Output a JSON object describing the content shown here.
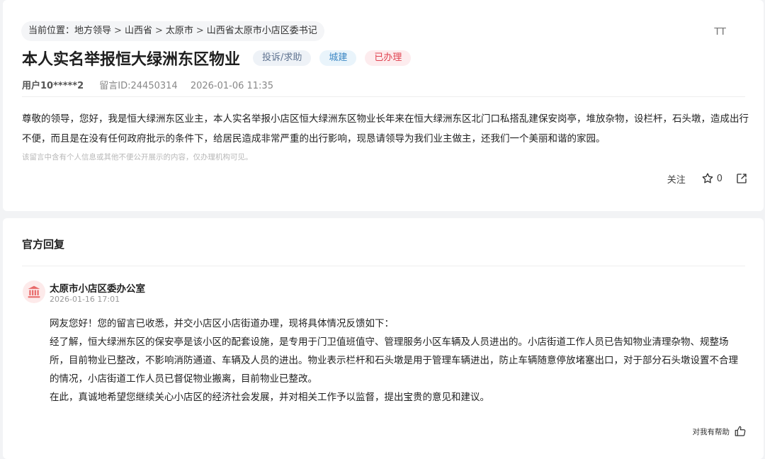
{
  "breadcrumb": {
    "prefix": "当前位置：",
    "items": [
      "地方领导",
      "山西省",
      "太原市",
      "山西省太原市小店区委书记"
    ],
    "separator": ">"
  },
  "font_size_toggle": "TT",
  "message": {
    "title": "本人实名举报恒大绿洲东区物业",
    "tags": {
      "type": "投诉/求助",
      "category": "城建",
      "status": "已办理"
    },
    "tag_colors": {
      "type": "#5f7390",
      "category": "#3b87c4",
      "status": "#e0414f"
    },
    "user": "用户10*****2",
    "message_id": "留言ID:24450314",
    "datetime": "2026-01-06 11:35",
    "content": "尊敬的领导，您好，我是恒大绿洲东区业主，本人实名举报小店区恒大绿洲东区物业长年来在恒大绿洲东区北门口私搭乱建保安岗亭，堆放杂物，设栏杆，石头墩，造成出行不便，而且是在没有任何政府批示的条件下，给居民造成非常严重的出行影响，现恳请领导为我们业主做主，还我们一个美丽和谐的家园。",
    "privacy_notice": "该留言中含有个人信息或其他不便公开展示的内容，仅办理机构可见。",
    "actions": {
      "follow_label": "关注",
      "star_icon": "star-icon",
      "star_count": "0",
      "share_icon": "share-icon"
    }
  },
  "reply": {
    "heading": "官方回复",
    "department_icon": "government-building-icon",
    "department": "太原市小店区委办公室",
    "date": "2026-01-16 17:01",
    "paragraphs": [
      "网友您好！您的留言已收悉，并交小店区小店街道办理，现将具体情况反馈如下：",
      "经了解，恒大绿洲东区的保安亭是该小区的配套设施，是专用于门卫值班值守、管理服务小区车辆及人员进出的。小店街道工作人员已告知物业清理杂物、规整场所，目前物业已整改，不影响消防通道、车辆及人员的进出。物业表示栏杆和石头墩是用于管理车辆进出，防止车辆随意停放堵塞出口，对于部分石头墩设置不合理的情况，小店街道工作人员已督促物业搬离，目前物业已整改。",
      "在此，真诚地希望您继续关心小店区的经济社会发展，并对相关工作予以监督，提出宝贵的意见和建议。"
    ],
    "helpful_label": "对我有帮助",
    "helpful_icon": "thumbs-up-icon"
  }
}
